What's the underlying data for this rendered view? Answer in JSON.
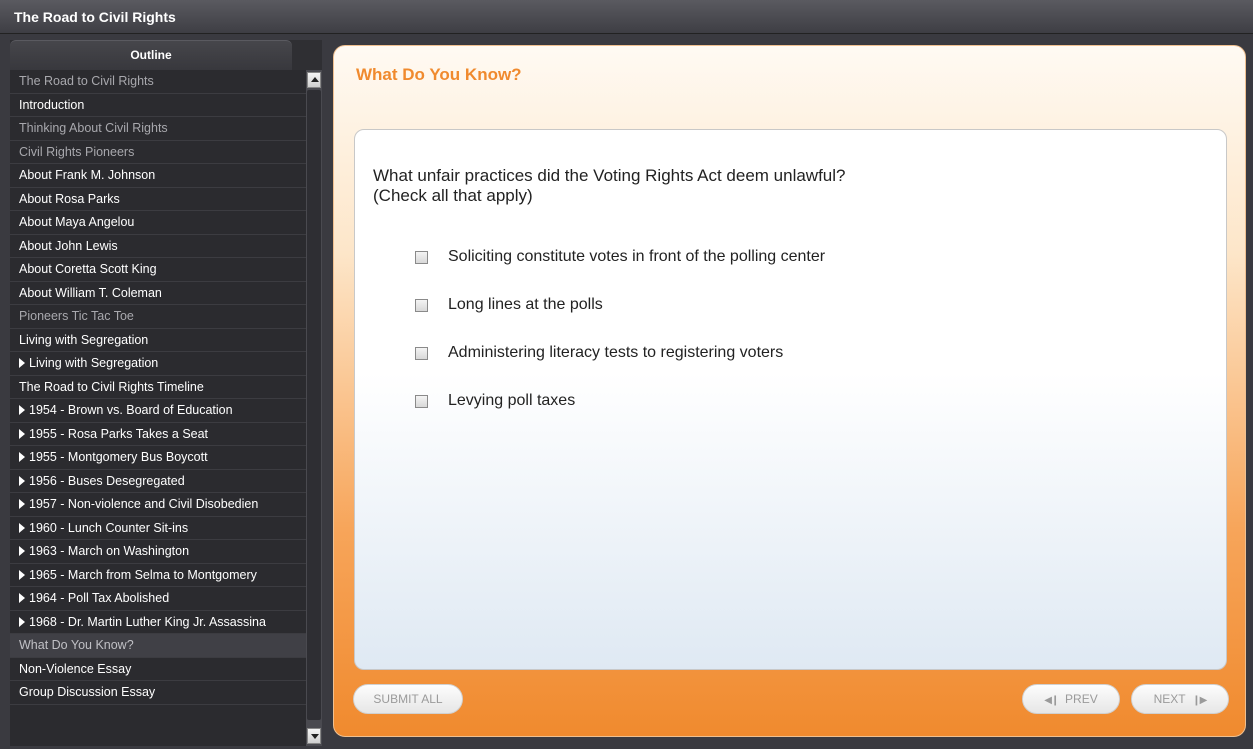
{
  "window": {
    "title": "The Road to Civil Rights"
  },
  "sidebar": {
    "tab_label": "Outline",
    "items": [
      {
        "label": "The Road to Civil Rights",
        "dim": true,
        "arrow": false
      },
      {
        "label": "Introduction",
        "dim": false,
        "arrow": false
      },
      {
        "label": "Thinking About Civil Rights",
        "dim": true,
        "arrow": false
      },
      {
        "label": "Civil Rights Pioneers",
        "dim": true,
        "arrow": false
      },
      {
        "label": "About Frank M. Johnson",
        "dim": false,
        "arrow": false
      },
      {
        "label": "About Rosa Parks",
        "dim": false,
        "arrow": false
      },
      {
        "label": "About Maya Angelou",
        "dim": false,
        "arrow": false
      },
      {
        "label": "About John Lewis",
        "dim": false,
        "arrow": false
      },
      {
        "label": "About Coretta Scott King",
        "dim": false,
        "arrow": false
      },
      {
        "label": "About William T. Coleman",
        "dim": false,
        "arrow": false
      },
      {
        "label": "Pioneers Tic Tac Toe",
        "dim": true,
        "arrow": false
      },
      {
        "label": "Living with Segregation",
        "dim": false,
        "arrow": false
      },
      {
        "label": "Living with Segregation",
        "dim": false,
        "arrow": true
      },
      {
        "label": "The Road to Civil Rights Timeline",
        "dim": false,
        "arrow": false
      },
      {
        "label": "1954 - Brown vs. Board of Education",
        "dim": false,
        "arrow": true
      },
      {
        "label": "1955 - Rosa Parks Takes a Seat",
        "dim": false,
        "arrow": true
      },
      {
        "label": "1955 - Montgomery Bus Boycott",
        "dim": false,
        "arrow": true
      },
      {
        "label": "1956 - Buses Desegregated",
        "dim": false,
        "arrow": true
      },
      {
        "label": "1957 - Non-violence and Civil Disobedien",
        "dim": false,
        "arrow": true
      },
      {
        "label": "1960 - Lunch Counter Sit-ins",
        "dim": false,
        "arrow": true
      },
      {
        "label": "1963 - March on Washington",
        "dim": false,
        "arrow": true
      },
      {
        "label": "1965 - March from Selma to Montgomery",
        "dim": false,
        "arrow": true
      },
      {
        "label": "1964 - Poll Tax Abolished",
        "dim": false,
        "arrow": true
      },
      {
        "label": "1968 - Dr. Martin Luther King Jr. Assassina",
        "dim": false,
        "arrow": true
      },
      {
        "label": "What Do You Know?",
        "dim": true,
        "arrow": false,
        "active": true
      },
      {
        "label": "Non-Violence Essay",
        "dim": false,
        "arrow": false
      },
      {
        "label": "Group Discussion Essay",
        "dim": false,
        "arrow": false
      }
    ]
  },
  "main": {
    "heading": "What Do You Know?",
    "question": {
      "line1": "What unfair practices did the Voting Rights Act deem unlawful?",
      "line2": "(Check all that apply)"
    },
    "options": [
      {
        "label": "Soliciting constitute votes in front of the polling center",
        "checked": false
      },
      {
        "label": "Long lines at the polls",
        "checked": false
      },
      {
        "label": "Administering literacy tests to registering voters",
        "checked": false
      },
      {
        "label": "Levying poll taxes",
        "checked": false
      }
    ],
    "buttons": {
      "submit_label": "SUBMIT ALL",
      "prev_label": "PREV",
      "next_label": "NEXT"
    }
  },
  "colors": {
    "accent": "#f08a2e",
    "sidebar_bg": "#2b2b2f",
    "titlebar_bg": "#3e3e44"
  }
}
